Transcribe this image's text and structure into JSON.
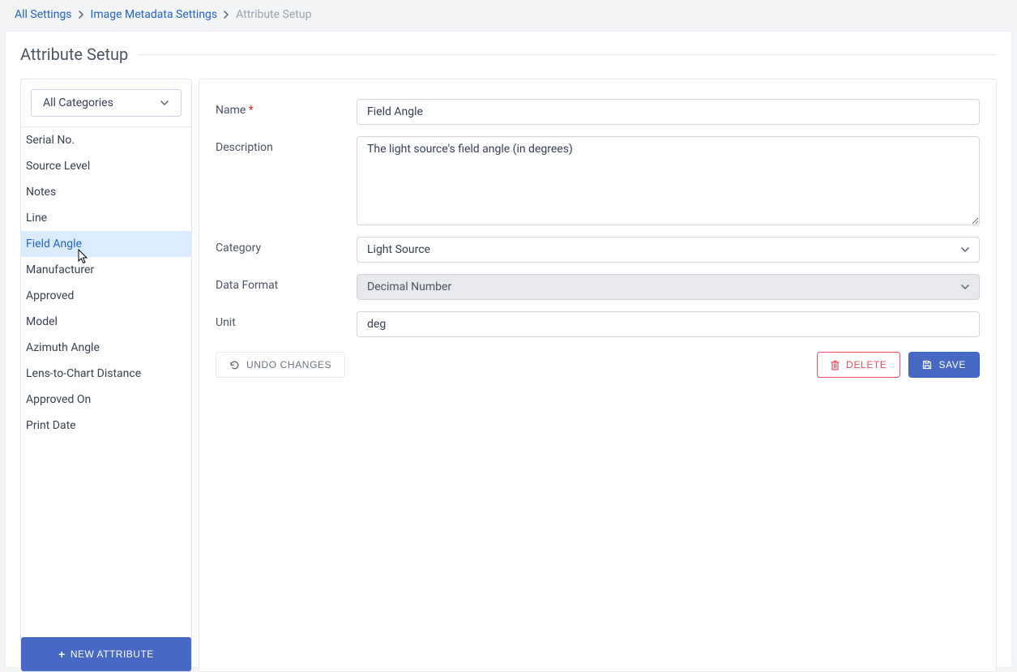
{
  "breadcrumb": {
    "items": [
      {
        "label": "All Settings"
      },
      {
        "label": "Image Metadata Settings"
      }
    ],
    "current": "Attribute Setup"
  },
  "page_title": "Attribute Setup",
  "sidebar": {
    "category_filter": "All Categories",
    "attributes": [
      {
        "label": "Serial No."
      },
      {
        "label": "Source Level"
      },
      {
        "label": "Notes"
      },
      {
        "label": "Line"
      },
      {
        "label": "Field Angle",
        "selected": true
      },
      {
        "label": "Manufacturer"
      },
      {
        "label": "Approved"
      },
      {
        "label": "Model"
      },
      {
        "label": "Azimuth Angle"
      },
      {
        "label": "Lens-to-Chart Distance"
      },
      {
        "label": "Approved On"
      },
      {
        "label": "Print Date"
      }
    ],
    "new_button": "NEW ATTRIBUTE"
  },
  "form": {
    "labels": {
      "name": "Name",
      "description": "Description",
      "category": "Category",
      "data_format": "Data Format",
      "unit": "Unit"
    },
    "values": {
      "name": "Field Angle",
      "description": "The light source's field angle (in degrees)",
      "category": "Light Source",
      "data_format": "Decimal Number",
      "unit": "deg"
    }
  },
  "actions": {
    "undo": "UNDO CHANGES",
    "delete": "DELETE",
    "save": "SAVE"
  }
}
